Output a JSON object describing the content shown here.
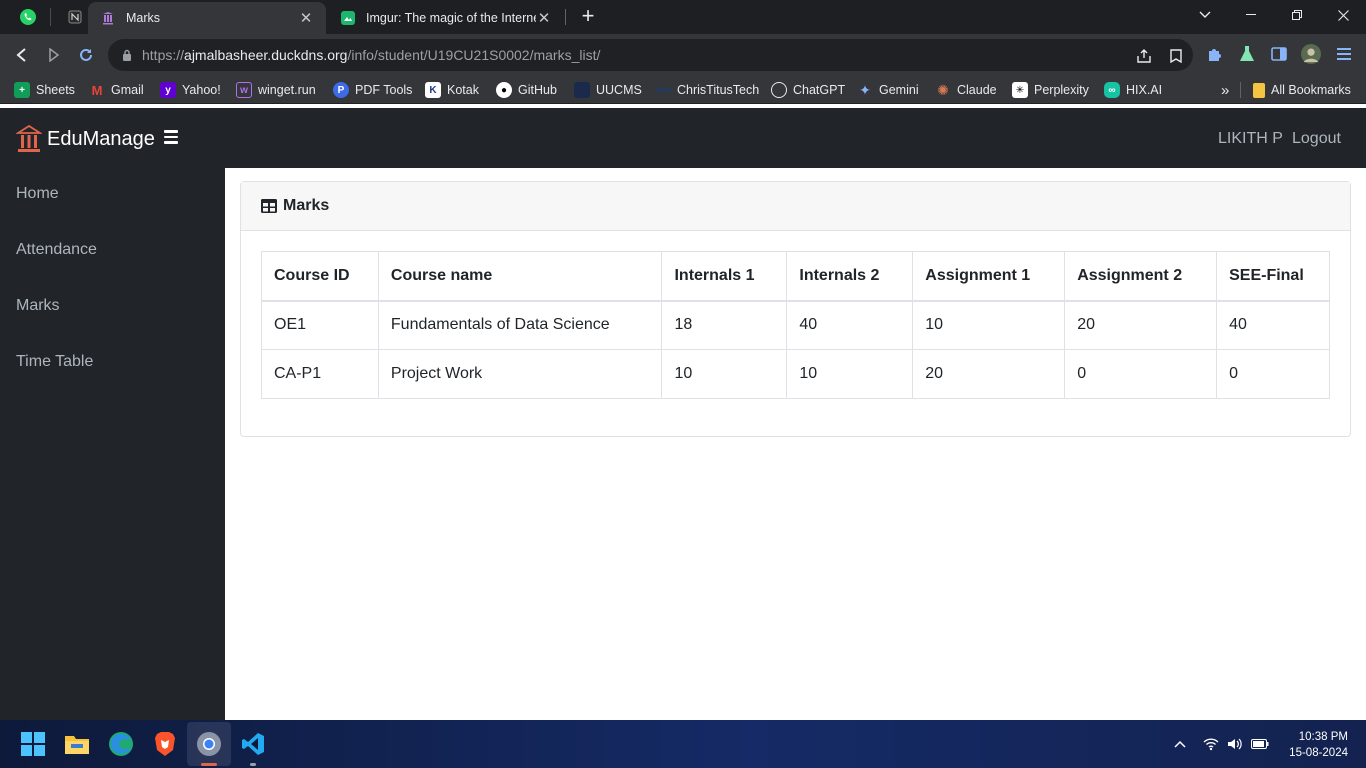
{
  "browser": {
    "tabs": [
      {
        "title": "Marks",
        "active": true
      },
      {
        "title": "Imgur: The magic of the Internet",
        "active": false
      }
    ],
    "url_scheme": "https://",
    "url_host": "ajmalbasheer.duckdns.org",
    "url_path": "/info/student/U19CU21S0002/marks_list/",
    "bookmarks": [
      "Sheets",
      "Gmail",
      "Yahoo!",
      "winget.run",
      "PDF Tools",
      "Kotak",
      "GitHub",
      "UUCMS",
      "ChrisTitusTech",
      "ChatGPT",
      "Gemini",
      "Claude",
      "Perplexity",
      "HIX.AI"
    ],
    "bookmarks_overflow": "»",
    "all_bookmarks": "All Bookmarks"
  },
  "app": {
    "brand": "EduManage",
    "user": "LIKITH P",
    "logout": "Logout",
    "sidebar": [
      "Home",
      "Attendance",
      "Marks",
      "Time Table"
    ]
  },
  "marks": {
    "title": "Marks",
    "columns": [
      "Course ID",
      "Course name",
      "Internals 1",
      "Internals 2",
      "Assignment 1",
      "Assignment 2",
      "SEE-Final"
    ],
    "rows": [
      [
        "OE1",
        "Fundamentals of Data Science",
        "18",
        "40",
        "10",
        "20",
        "40"
      ],
      [
        "CA-P1",
        "Project Work",
        "10",
        "10",
        "20",
        "0",
        "0"
      ]
    ]
  },
  "taskbar": {
    "time": "10:38 PM",
    "date": "15-08-2024"
  },
  "colors": {
    "navbar": "#212529",
    "accent": "#e0654a"
  }
}
